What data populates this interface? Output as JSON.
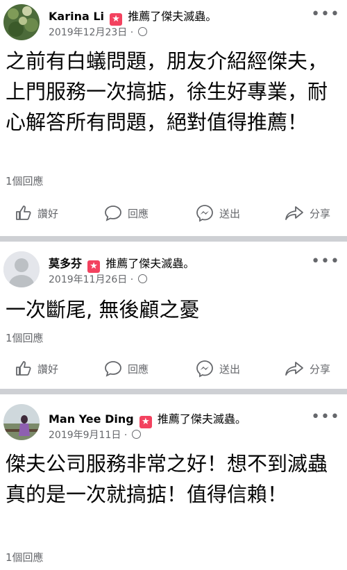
{
  "posts": [
    {
      "name": "Karina Li",
      "recommend_text": "推薦了傑夫滅蟲。",
      "date": "2019年12月23日",
      "separator": "·",
      "body": "之前有白蟻問題，朋友介紹經傑夫，上門服務一次搞掂，徐生好專業，耐心解答所有問題，絕對值得推薦！",
      "reply_count": "1個回應"
    },
    {
      "name": "莫多芬",
      "recommend_text": "推薦了傑夫滅蟲。",
      "date": "2019年11月26日",
      "separator": "·",
      "body": "一次斷尾, 無後顧之憂",
      "reply_count": "1個回應"
    },
    {
      "name": "Man Yee Ding",
      "recommend_text": "推薦了傑夫滅蟲。",
      "date": "2019年9月11日",
      "separator": "·",
      "body": "傑夫公司服務非常之好！想不到滅蟲真的是一次就搞掂！值得信賴！",
      "reply_count": "1個回應"
    }
  ],
  "actions": {
    "like": "讚好",
    "comment": "回應",
    "share_send": "送出",
    "share": "分享"
  },
  "icons": {
    "badge": "star-badge-icon",
    "privacy": "globe-icon",
    "more": "more-options-icon",
    "like": "thumbs-up-icon",
    "comment": "comment-bubble-icon",
    "send": "messenger-icon",
    "share": "share-arrow-icon"
  },
  "colors": {
    "badge": "#f3425f",
    "meta": "#65676b",
    "separator": "#ced0d4"
  }
}
